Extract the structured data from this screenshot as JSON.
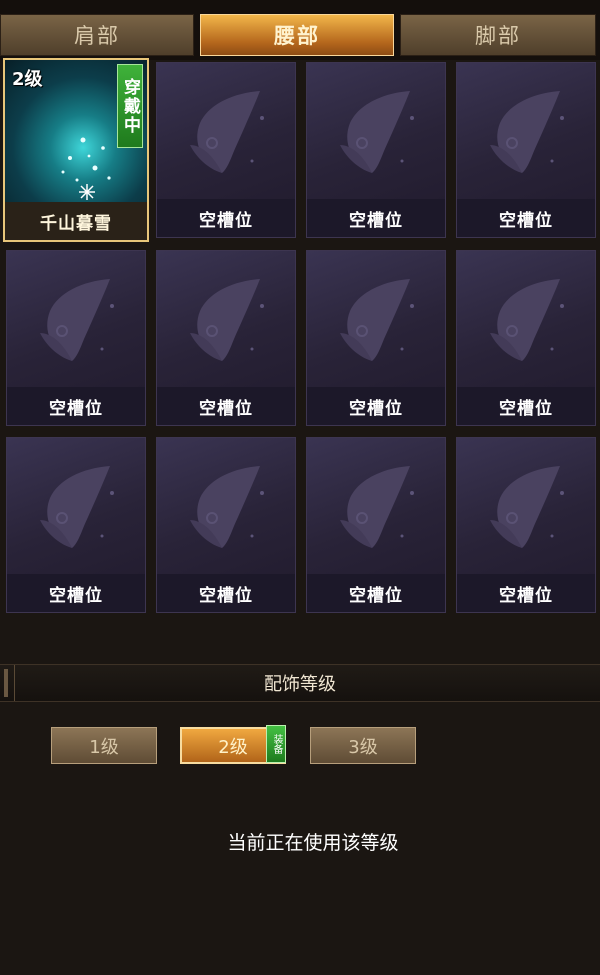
{
  "tabs": [
    {
      "label": "肩部",
      "active": false
    },
    {
      "label": "腰部",
      "active": true
    },
    {
      "label": "脚部",
      "active": false
    }
  ],
  "slots": [
    {
      "label": "千山暮雪",
      "level": "2级",
      "wearing": "穿戴中",
      "equipped": true
    },
    {
      "label": "空槽位"
    },
    {
      "label": "空槽位"
    },
    {
      "label": "空槽位"
    },
    {
      "label": "空槽位"
    },
    {
      "label": "空槽位"
    },
    {
      "label": "空槽位"
    },
    {
      "label": "空槽位"
    },
    {
      "label": "空槽位"
    },
    {
      "label": "空槽位"
    },
    {
      "label": "空槽位"
    },
    {
      "label": "空槽位"
    }
  ],
  "section": {
    "title": "配饰等级"
  },
  "levels": [
    {
      "label": "1级",
      "active": false
    },
    {
      "label": "2级",
      "active": true
    },
    {
      "label": "3级",
      "active": false
    }
  ],
  "equip_badge": "装备",
  "status_text": "当前正在使用该等级",
  "colors": {
    "accent": "#f0a840",
    "equipped_tag": "#2e9a2b",
    "slot_bg": "#2a2438"
  }
}
